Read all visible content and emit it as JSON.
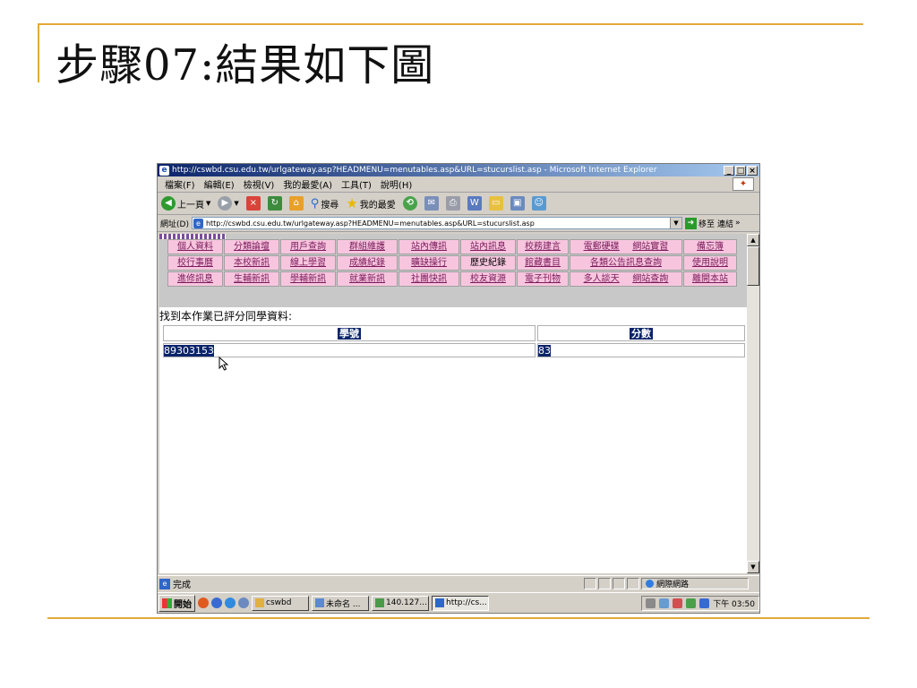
{
  "slide": {
    "title": "步驟07:結果如下圖"
  },
  "window": {
    "title": "http://cswbd.csu.edu.tw/urlgateway.asp?HEADMENU=menutables.asp&URL=stucurslist.asp - Microsoft Internet Explorer",
    "controls": {
      "minimize": "_",
      "maximize": "□",
      "close": "×"
    }
  },
  "menubar": {
    "items": [
      "檔案(F)",
      "編輯(E)",
      "檢視(V)",
      "我的最愛(A)",
      "工具(T)",
      "說明(H)"
    ]
  },
  "toolbar": {
    "back": "上一頁",
    "search": "搜尋",
    "favorites": "我的最愛"
  },
  "addressbar": {
    "label": "網址(D)",
    "url": "http://cswbd.csu.edu.tw/urlgateway.asp?HEADMENU=menutables.asp&URL=stucurslist.asp",
    "go": "移至",
    "links": "連結",
    "more": "»"
  },
  "nav": {
    "rows": [
      [
        "個人資料",
        "分類論壇",
        "用戶查詢",
        "群組維護",
        "站內傳訊",
        "站內訊息",
        "校務建言",
        "電郵硬碟",
        "網站實習",
        "備忘簿"
      ],
      [
        "校行事曆",
        "本校新訊",
        "線上學習",
        "成績紀錄",
        "曠缺操行",
        "歷史紀錄",
        "館藏書目",
        "各類公告訊息查詢",
        "使用說明"
      ],
      [
        "進修訊息",
        "生輔新訊",
        "學輔新訊",
        "就業新訊",
        "社團快訊",
        "校友資源",
        "電子刊物",
        "多人談天",
        "網站查詢",
        "離開本站"
      ]
    ]
  },
  "results": {
    "heading": "找到本作業已評分同學資料:",
    "columns": [
      "學號",
      "分數"
    ],
    "rows": [
      {
        "student_id": "89303153",
        "score": "83"
      }
    ]
  },
  "statusbar": {
    "text": "完成",
    "zone": "網際網路"
  },
  "taskbar": {
    "start": "開始",
    "tasks": [
      "cswbd",
      "未命名 ...",
      "140.127...",
      "http://cs..."
    ],
    "clock": "下午 03:50"
  }
}
